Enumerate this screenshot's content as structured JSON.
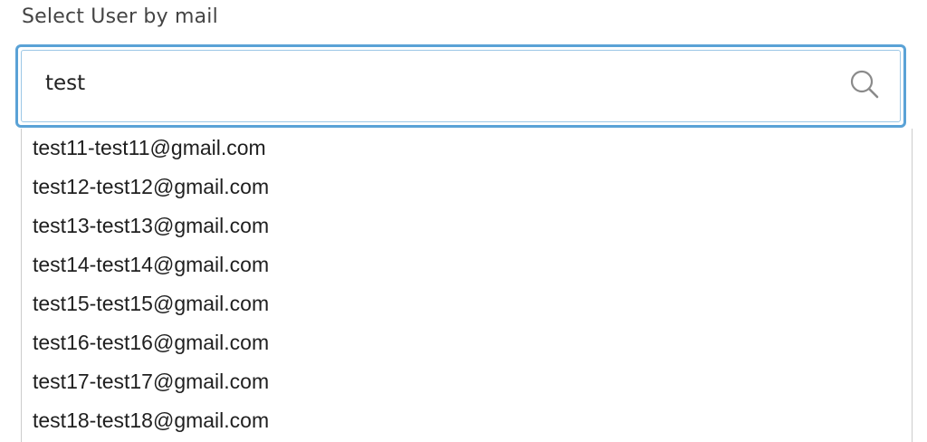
{
  "form": {
    "label": "Select User by mail"
  },
  "search": {
    "value": "test",
    "icon": "search-icon"
  },
  "dropdown": {
    "options": [
      "test11-test11@gmail.com",
      "test12-test12@gmail.com",
      "test13-test13@gmail.com",
      "test14-test14@gmail.com",
      "test15-test15@gmail.com",
      "test16-test16@gmail.com",
      "test17-test17@gmail.com",
      "test18-test18@gmail.com"
    ]
  },
  "colors": {
    "focus_border": "#5aa2d6",
    "label_text": "#444444",
    "option_text": "#1f1f1f",
    "icon": "#8a8a8a"
  }
}
